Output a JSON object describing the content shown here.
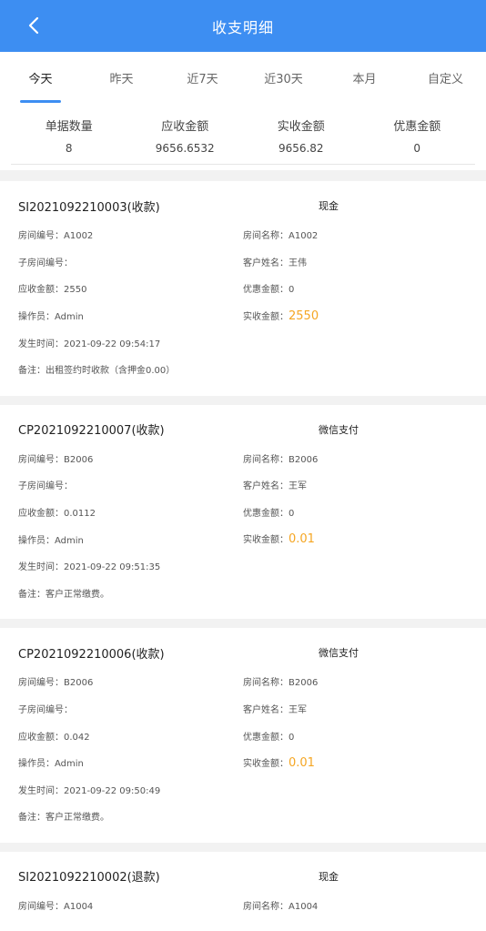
{
  "header": {
    "title": "收支明细"
  },
  "tabs": [
    {
      "label": "今天",
      "active": true
    },
    {
      "label": "昨天",
      "active": false
    },
    {
      "label": "近7天",
      "active": false
    },
    {
      "label": "近30天",
      "active": false
    },
    {
      "label": "本月",
      "active": false
    },
    {
      "label": "自定义",
      "active": false
    }
  ],
  "summary": [
    {
      "label": "单据数量",
      "value": "8"
    },
    {
      "label": "应收金额",
      "value": "9656.6532"
    },
    {
      "label": "实收金额",
      "value": "9656.82"
    },
    {
      "label": "优惠金额",
      "value": "0"
    }
  ],
  "labels": {
    "room_no": "房间编号：",
    "room_name": "房间名称：",
    "sub_room": "子房间编号：",
    "customer": "客户姓名：",
    "receivable": "应收金额：",
    "discount": "优惠金额：",
    "operator": "操作员：",
    "received": "实收金额：",
    "time": "发生时间：",
    "remark": "备注："
  },
  "records": [
    {
      "no": "SI2021092210003(收款)",
      "pay": "现金",
      "room_no": "A1002",
      "room_name": "A1002",
      "sub_room": "",
      "customer": "王伟",
      "receivable": "2550",
      "discount": "0",
      "operator": "Admin",
      "received": "2550",
      "time": "2021-09-22 09:54:17",
      "remark": "出租签约时收款（含押金0.00）"
    },
    {
      "no": "CP2021092210007(收款)",
      "pay": "微信支付",
      "room_no": "B2006",
      "room_name": "B2006",
      "sub_room": "",
      "customer": "王军",
      "receivable": "0.0112",
      "discount": "0",
      "operator": "Admin",
      "received": "0.01",
      "time": "2021-09-22 09:51:35",
      "remark": "客户正常缴费。"
    },
    {
      "no": "CP2021092210006(收款)",
      "pay": "微信支付",
      "room_no": "B2006",
      "room_name": "B2006",
      "sub_room": "",
      "customer": "王军",
      "receivable": "0.042",
      "discount": "0",
      "operator": "Admin",
      "received": "0.01",
      "time": "2021-09-22 09:50:49",
      "remark": "客户正常缴费。"
    },
    {
      "no": "SI2021092210002(退款)",
      "pay": "现金",
      "room_no": "A1004",
      "room_name": "A1004"
    }
  ]
}
